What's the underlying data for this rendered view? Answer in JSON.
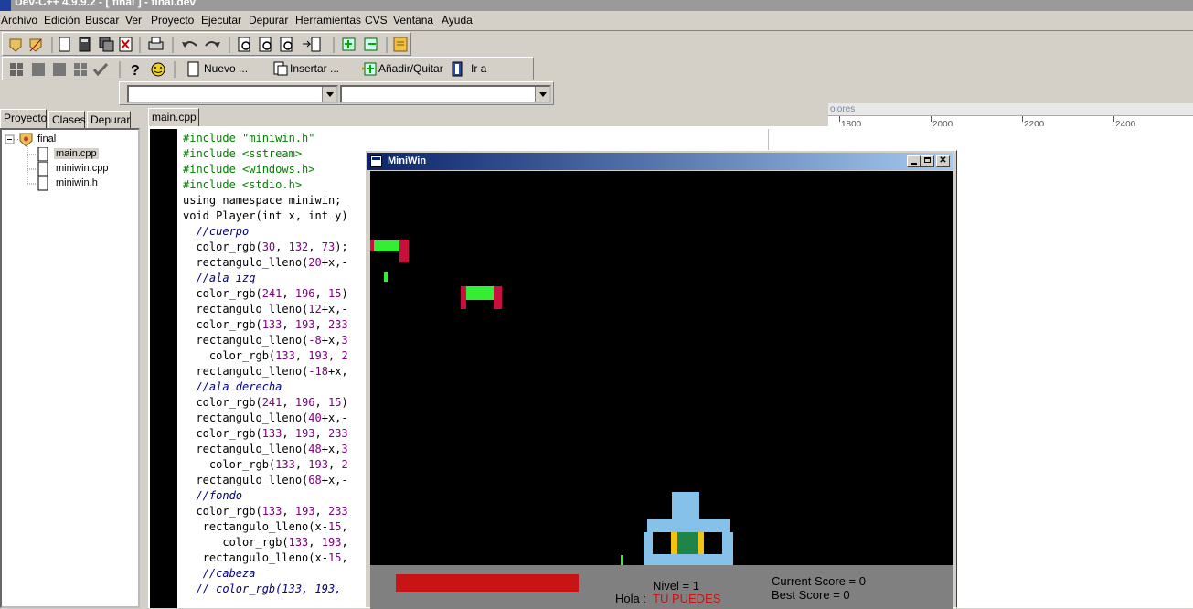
{
  "window": {
    "title": "Dev-C++ 4.9.9.2  - [ final ] - final.dev"
  },
  "menu": [
    "Archivo",
    "Edición",
    "Buscar",
    "Ver",
    "Proyecto",
    "Ejecutar",
    "Depurar",
    "Herramientas",
    "CVS",
    "Ventana",
    "Ayuda"
  ],
  "toolbar2": {
    "new_label": "Nuevo ...",
    "insert_label": "Insertar ...",
    "addremove_label": "Añadir/Quitar",
    "goto_label": "Ir a"
  },
  "left_tabs": [
    "Proyecto",
    "Clases",
    "Depurar"
  ],
  "project_tree": {
    "root": "final",
    "files": [
      "main.cpp",
      "miniwin.cpp",
      "miniwin.h"
    ]
  },
  "editor_tab": "main.cpp",
  "background_panel": {
    "label": "olores",
    "ruler": [
      "1800",
      "2000",
      "2200",
      "2400"
    ]
  },
  "code_lines": [
    {
      "indent": "",
      "parts": [
        {
          "t": "#include \"miniwin.h\"",
          "c": "green"
        }
      ]
    },
    {
      "indent": "",
      "parts": [
        {
          "t": "#include <sstream>",
          "c": "green"
        }
      ]
    },
    {
      "indent": "",
      "parts": [
        {
          "t": "#include <windows.h>",
          "c": "green"
        }
      ]
    },
    {
      "indent": "",
      "parts": [
        {
          "t": "#include <stdio.h>",
          "c": "green"
        }
      ]
    },
    {
      "indent": "",
      "parts": [
        {
          "t": "using namespace miniwin;",
          "c": "black"
        }
      ]
    },
    {
      "indent": "",
      "parts": [
        {
          "t": "void Player(int x, int y)",
          "c": "black"
        }
      ]
    },
    {
      "indent": "  ",
      "parts": [
        {
          "t": "//cuerpo",
          "c": "navy"
        }
      ]
    },
    {
      "indent": "  ",
      "parts": [
        {
          "t": "color_rgb(",
          "c": "black"
        },
        {
          "t": "30",
          "c": "purple"
        },
        {
          "t": ", ",
          "c": "black"
        },
        {
          "t": "132",
          "c": "purple"
        },
        {
          "t": ", ",
          "c": "black"
        },
        {
          "t": "73",
          "c": "purple"
        },
        {
          "t": ");",
          "c": "black"
        }
      ]
    },
    {
      "indent": "  ",
      "parts": [
        {
          "t": "rectangulo_lleno(",
          "c": "black"
        },
        {
          "t": "20",
          "c": "purple"
        },
        {
          "t": "+x,-",
          "c": "black"
        }
      ]
    },
    {
      "indent": "  ",
      "parts": [
        {
          "t": "//ala izq",
          "c": "navy"
        }
      ]
    },
    {
      "indent": "  ",
      "parts": [
        {
          "t": "color_rgb(",
          "c": "black"
        },
        {
          "t": "241",
          "c": "purple"
        },
        {
          "t": ", ",
          "c": "black"
        },
        {
          "t": "196",
          "c": "purple"
        },
        {
          "t": ", ",
          "c": "black"
        },
        {
          "t": "15",
          "c": "purple"
        },
        {
          "t": ")",
          "c": "black"
        }
      ]
    },
    {
      "indent": "  ",
      "parts": [
        {
          "t": "rectangulo_lleno(",
          "c": "black"
        },
        {
          "t": "12",
          "c": "purple"
        },
        {
          "t": "+x,-",
          "c": "black"
        }
      ]
    },
    {
      "indent": "  ",
      "parts": [
        {
          "t": "color_rgb(",
          "c": "black"
        },
        {
          "t": "133",
          "c": "purple"
        },
        {
          "t": ", ",
          "c": "black"
        },
        {
          "t": "193",
          "c": "purple"
        },
        {
          "t": ", ",
          "c": "black"
        },
        {
          "t": "233",
          "c": "purple"
        }
      ]
    },
    {
      "indent": "  ",
      "parts": [
        {
          "t": "rectangulo_lleno(",
          "c": "black"
        },
        {
          "t": "-8",
          "c": "purple"
        },
        {
          "t": "+x,",
          "c": "black"
        },
        {
          "t": "3",
          "c": "purple"
        }
      ]
    },
    {
      "indent": "    ",
      "parts": [
        {
          "t": "color_rgb(",
          "c": "black"
        },
        {
          "t": "133",
          "c": "purple"
        },
        {
          "t": ", ",
          "c": "black"
        },
        {
          "t": "193",
          "c": "purple"
        },
        {
          "t": ", ",
          "c": "black"
        },
        {
          "t": "2",
          "c": "purple"
        }
      ]
    },
    {
      "indent": "  ",
      "parts": [
        {
          "t": "rectangulo_lleno(",
          "c": "black"
        },
        {
          "t": "-18",
          "c": "purple"
        },
        {
          "t": "+x,",
          "c": "black"
        }
      ]
    },
    {
      "indent": "  ",
      "parts": [
        {
          "t": "//ala derecha",
          "c": "navy"
        }
      ]
    },
    {
      "indent": "  ",
      "parts": [
        {
          "t": "color_rgb(",
          "c": "black"
        },
        {
          "t": "241",
          "c": "purple"
        },
        {
          "t": ", ",
          "c": "black"
        },
        {
          "t": "196",
          "c": "purple"
        },
        {
          "t": ", ",
          "c": "black"
        },
        {
          "t": "15",
          "c": "purple"
        },
        {
          "t": ")",
          "c": "black"
        }
      ]
    },
    {
      "indent": "  ",
      "parts": [
        {
          "t": "rectangulo_lleno(",
          "c": "black"
        },
        {
          "t": "40",
          "c": "purple"
        },
        {
          "t": "+x,-",
          "c": "black"
        }
      ]
    },
    {
      "indent": "  ",
      "parts": [
        {
          "t": "color_rgb(",
          "c": "black"
        },
        {
          "t": "133",
          "c": "purple"
        },
        {
          "t": ", ",
          "c": "black"
        },
        {
          "t": "193",
          "c": "purple"
        },
        {
          "t": ", ",
          "c": "black"
        },
        {
          "t": "233",
          "c": "purple"
        }
      ]
    },
    {
      "indent": "  ",
      "parts": [
        {
          "t": "rectangulo_lleno(",
          "c": "black"
        },
        {
          "t": "48",
          "c": "purple"
        },
        {
          "t": "+x,",
          "c": "black"
        },
        {
          "t": "3",
          "c": "purple"
        }
      ]
    },
    {
      "indent": "    ",
      "parts": [
        {
          "t": "color_rgb(",
          "c": "black"
        },
        {
          "t": "133",
          "c": "purple"
        },
        {
          "t": ", ",
          "c": "black"
        },
        {
          "t": "193",
          "c": "purple"
        },
        {
          "t": ", ",
          "c": "black"
        },
        {
          "t": "2",
          "c": "purple"
        }
      ]
    },
    {
      "indent": "  ",
      "parts": [
        {
          "t": "rectangulo_lleno(",
          "c": "black"
        },
        {
          "t": "68",
          "c": "purple"
        },
        {
          "t": "+x,-",
          "c": "black"
        }
      ]
    },
    {
      "indent": "  ",
      "parts": [
        {
          "t": "//fondo",
          "c": "navy"
        }
      ]
    },
    {
      "indent": "  ",
      "parts": [
        {
          "t": "color_rgb(",
          "c": "black"
        },
        {
          "t": "133",
          "c": "purple"
        },
        {
          "t": ", ",
          "c": "black"
        },
        {
          "t": "193",
          "c": "purple"
        },
        {
          "t": ", ",
          "c": "black"
        },
        {
          "t": "233",
          "c": "purple"
        }
      ]
    },
    {
      "indent": "   ",
      "parts": [
        {
          "t": "rectangulo_lleno(x-",
          "c": "black"
        },
        {
          "t": "15",
          "c": "purple"
        },
        {
          "t": ",",
          "c": "black"
        }
      ]
    },
    {
      "indent": "      ",
      "parts": [
        {
          "t": "color_rgb(",
          "c": "black"
        },
        {
          "t": "133",
          "c": "purple"
        },
        {
          "t": ", ",
          "c": "black"
        },
        {
          "t": "193",
          "c": "purple"
        },
        {
          "t": ",",
          "c": "black"
        }
      ]
    },
    {
      "indent": "   ",
      "parts": [
        {
          "t": "rectangulo_lleno(x-",
          "c": "black"
        },
        {
          "t": "15",
          "c": "purple"
        },
        {
          "t": ",",
          "c": "black"
        }
      ]
    },
    {
      "indent": "   ",
      "parts": [
        {
          "t": "//cabeza",
          "c": "navy"
        }
      ]
    },
    {
      "indent": "  ",
      "parts": [
        {
          "t": "// color_rgb(133, 193,",
          "c": "navy"
        }
      ]
    }
  ],
  "miniwin": {
    "title": "MiniWin",
    "hud": {
      "nivel": "Nivel = 1",
      "hola_prefix": "Hola :",
      "hola_msg": "TU PUEDES",
      "current_score": "Current Score = 0",
      "best_score": "Best Score = 0"
    }
  },
  "colors": {
    "code_green": "#008000",
    "code_purple": "#800080",
    "code_comment": "#000080",
    "game_bg": "#000000",
    "enemy_green": "#33ee33",
    "enemy_red": "#c8103c",
    "player_blue": "#85c1e9",
    "player_green": "#1e8449",
    "player_yellow": "#f1c40f",
    "hud_red": "#c81414"
  }
}
